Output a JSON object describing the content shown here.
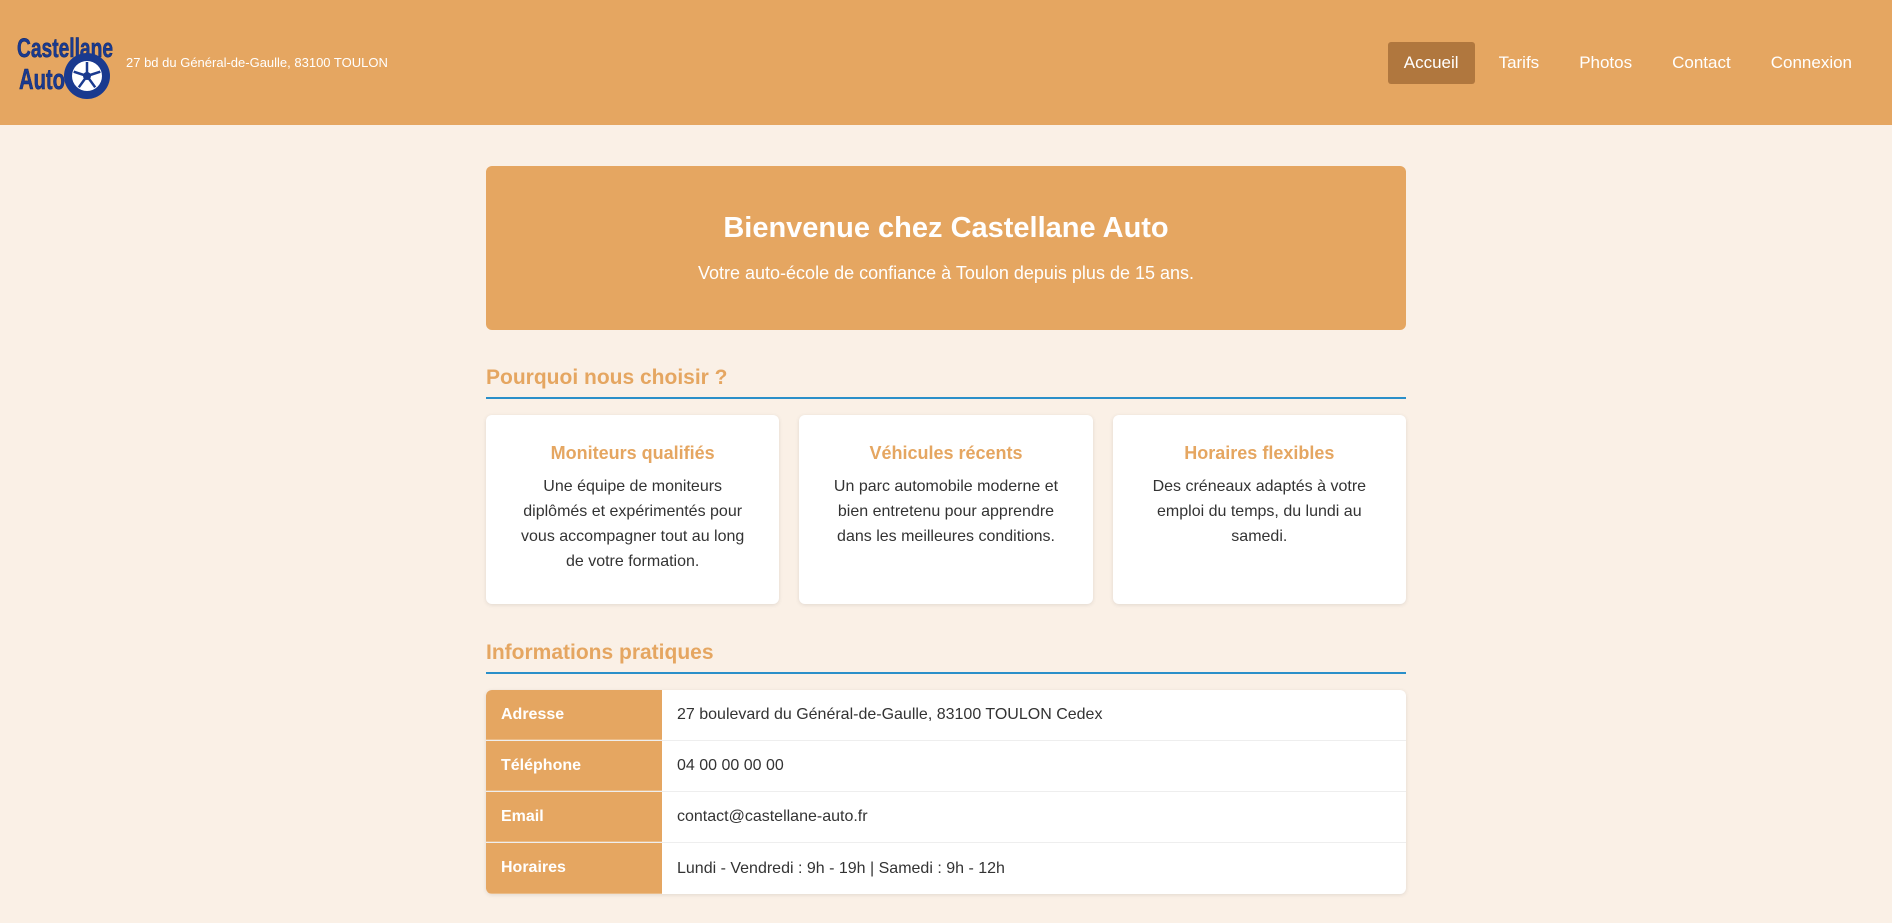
{
  "header": {
    "logo_text_line1": "Castellane",
    "logo_text_line2": "Auto",
    "address": "27 bd du Général-de-Gaulle, 83100 TOULON",
    "nav": [
      "Accueil",
      "Tarifs",
      "Photos",
      "Contact",
      "Connexion"
    ],
    "active_nav": "Accueil"
  },
  "hero": {
    "title": "Bienvenue chez Castellane Auto",
    "subtitle": "Votre auto-école de confiance à Toulon depuis plus de 15 ans."
  },
  "why": {
    "title": "Pourquoi nous choisir ?",
    "cards": [
      {
        "title": "Moniteurs qualifiés",
        "text": "Une équipe de moniteurs diplômés et expérimentés pour vous accompagner tout au long de votre formation."
      },
      {
        "title": "Véhicules récents",
        "text": "Un parc automobile moderne et bien entretenu pour apprendre dans les meilleures conditions."
      },
      {
        "title": "Horaires flexibles",
        "text": "Des créneaux adaptés à votre emploi du temps, du lundi au samedi."
      }
    ]
  },
  "info": {
    "title": "Informations pratiques",
    "rows": [
      {
        "label": "Adresse",
        "value": "27 boulevard du Général-de-Gaulle, 83100 TOULON Cedex"
      },
      {
        "label": "Téléphone",
        "value": "04 00 00 00 00"
      },
      {
        "label": "Email",
        "value": "contact@castellane-auto.fr"
      },
      {
        "label": "Horaires",
        "value": "Lundi - Vendredi : 9h - 19h | Samedi : 9h - 12h"
      }
    ]
  },
  "colors": {
    "primary": "#e5a661",
    "nav_active": "#b0773e",
    "page_background": "#faf0e6",
    "section_rule": "#2a8fc9",
    "logo_blue": "#1a3a8f"
  }
}
